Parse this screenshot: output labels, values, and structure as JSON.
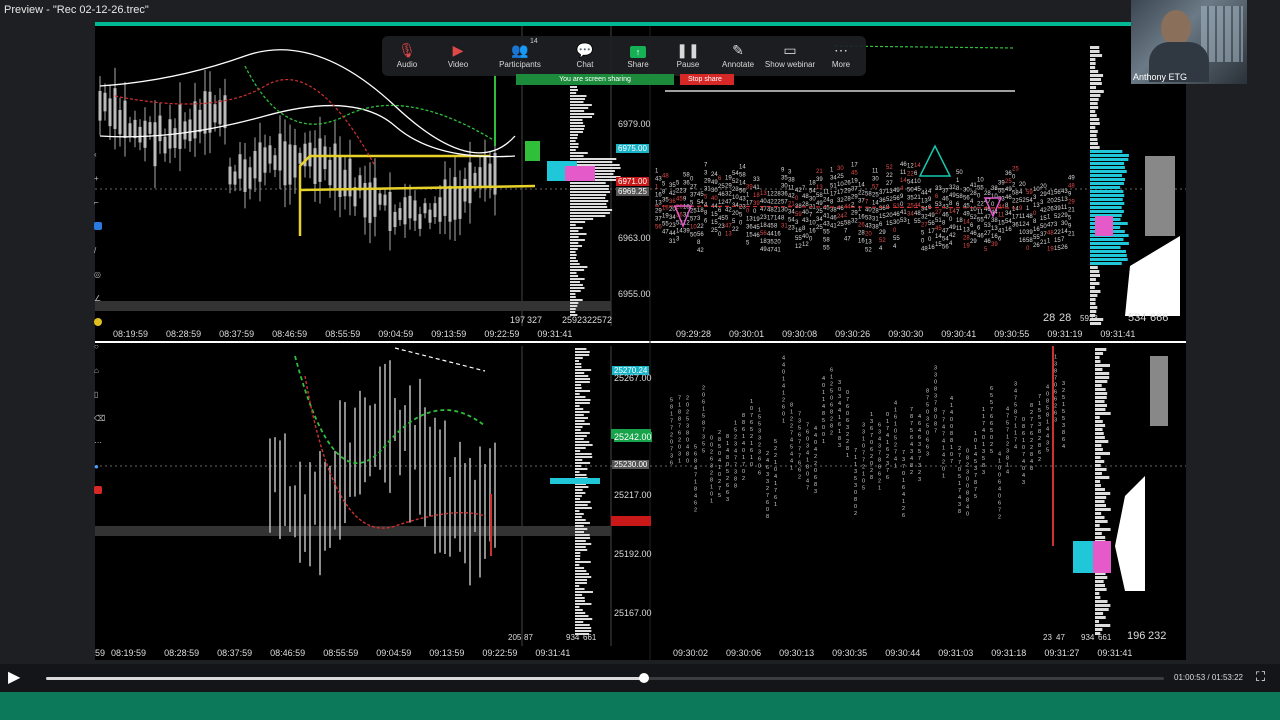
{
  "window": {
    "title": "Preview - \"Rec 02-12-26.trec\""
  },
  "toolbar": {
    "items": [
      {
        "label": "Audio",
        "icon": "microphone-icon"
      },
      {
        "label": "Video",
        "icon": "camera-icon"
      },
      {
        "label": "Participants",
        "icon": "people-icon",
        "count": "14"
      },
      {
        "label": "Chat",
        "icon": "chat-icon"
      },
      {
        "label": "Share",
        "icon": "share-icon"
      },
      {
        "label": "Pause",
        "icon": "pause-icon"
      },
      {
        "label": "Annotate",
        "icon": "pen-icon"
      },
      {
        "label": "Show webinar",
        "icon": "webinar-icon"
      },
      {
        "label": "More",
        "icon": "more-icon"
      }
    ],
    "sharing_label": "You are screen sharing",
    "stop_share_label": "Stop share"
  },
  "webcam": {
    "name": "Anthony ETG"
  },
  "charts": {
    "top_left": {
      "prices": [
        "6979.00",
        "6963.00",
        "6955.00"
      ],
      "tags": [
        "6975.00",
        "6971.00",
        "6969.25"
      ],
      "volumes": [
        "197",
        "327",
        "25923",
        "22572"
      ],
      "times": [
        "08:19:59",
        "08:28:59",
        "08:37:59",
        "08:46:59",
        "08:55:59",
        "09:04:59",
        "09:13:59",
        "09:22:59",
        "09:31:41"
      ]
    },
    "top_right": {
      "times": [
        "09:29:28",
        "09:30:01",
        "09:30:08",
        "09:30:26",
        "09:30:30",
        "09:30:41",
        "09:30:55",
        "09:31:19",
        "09:31:41"
      ],
      "footer": [
        "28",
        "28",
        "5923",
        "534",
        "666"
      ]
    },
    "bottom_left": {
      "prices": [
        "25267.00",
        "25242.00",
        "25217.00",
        "25192.00",
        "25167.00"
      ],
      "tags": [
        "25270.24",
        "25230.00"
      ],
      "volumes": [
        "205",
        "87",
        "934",
        "661"
      ],
      "times": [
        "59",
        "08:19:59",
        "08:28:59",
        "08:37:59",
        "08:46:59",
        "08:55:59",
        "09:04:59",
        "09:13:59",
        "09:22:59",
        "09:31:41"
      ]
    },
    "bottom_right": {
      "times": [
        "09:30:02",
        "09:30:06",
        "09:30:13",
        "09:30:35",
        "09:30:44",
        "09:31:03",
        "09:31:18",
        "09:31:27",
        "09:31:41"
      ],
      "footer": [
        "23",
        "47",
        "934",
        "661",
        "196",
        "232"
      ]
    }
  },
  "player": {
    "current": "01:00:53",
    "total": "01:53:22",
    "separator": "/",
    "progress": 0.535
  },
  "colors": {
    "accent": "#00b894",
    "sharing": "#1c8c3c",
    "stop": "#d72828"
  }
}
